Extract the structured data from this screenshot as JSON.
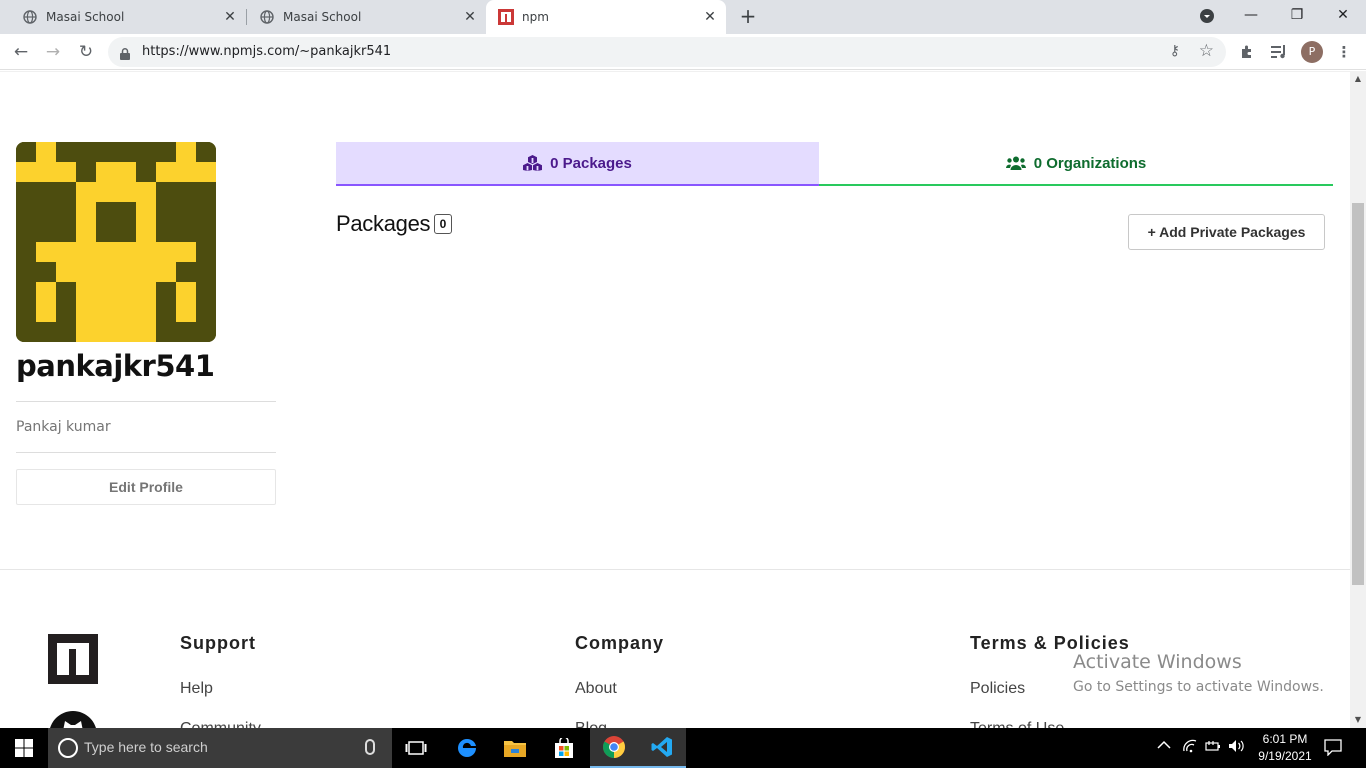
{
  "browser": {
    "tabs": [
      {
        "title": "Masai School",
        "icon": "globe-icon",
        "active": false
      },
      {
        "title": "Masai School",
        "icon": "globe-icon",
        "active": false
      },
      {
        "title": "npm",
        "icon": "npm-icon",
        "active": true
      }
    ],
    "url": "https://www.npmjs.com/~pankajkr541",
    "profile_initial": "P"
  },
  "profile": {
    "username": "pankajkr541",
    "full_name": "Pankaj kumar",
    "edit_label": "Edit Profile",
    "avatar_colors": {
      "background": "#4d4d0f",
      "foreground": "#fcd22d"
    }
  },
  "tabs": {
    "packages_label": "0 Packages",
    "organizations_label": "0 Organizations"
  },
  "packages": {
    "heading": "Packages",
    "count": "0",
    "add_label": "+ Add Private Packages"
  },
  "footer": {
    "support": {
      "heading": "Support",
      "links": [
        "Help",
        "Community"
      ]
    },
    "company": {
      "heading": "Company",
      "links": [
        "About",
        "Blog"
      ]
    },
    "terms": {
      "heading": "Terms & Policies",
      "links": [
        "Policies",
        "Terms of Use"
      ]
    }
  },
  "watermark": {
    "line1": "Activate Windows",
    "line2": "Go to Settings to activate Windows."
  },
  "taskbar": {
    "search_placeholder": "Type here to search",
    "time": "6:01 PM",
    "date": "9/19/2021"
  },
  "colors": {
    "packages_tab_bg": "#e4dcff",
    "packages_tab_accent": "#8956ff",
    "orgs_tab_accent": "#29c95d",
    "orgs_tab_text": "#0e6c2e"
  }
}
